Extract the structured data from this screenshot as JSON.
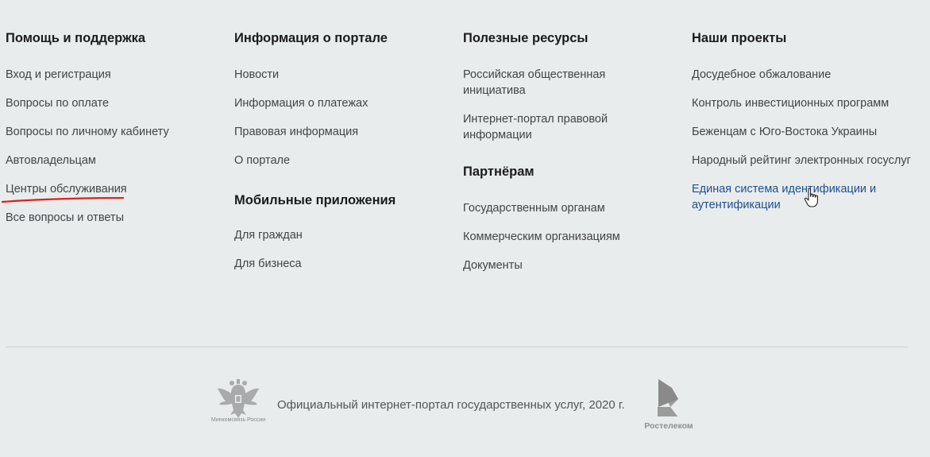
{
  "columns": [
    {
      "title": "Помощь и поддержка",
      "links": [
        "Вход и регистрация",
        "Вопросы по оплате",
        "Вопросы по личному кабинету",
        "Автовладельцам",
        "Центры обслуживания",
        "Все вопросы и ответы"
      ]
    },
    {
      "title": "Информация о портале",
      "links": [
        "Новости",
        "Информация о платежах",
        "Правовая информация",
        "О портале"
      ],
      "title2": "Мобильные приложения",
      "links2": [
        "Для граждан",
        "Для бизнеса"
      ]
    },
    {
      "title": "Полезные ресурсы",
      "links": [
        "Российская общественная инициатива",
        "Интернет-портал правовой информации"
      ],
      "title2": "Партнёрам",
      "links2": [
        "Государственным органам",
        "Коммерческим организациям",
        "Документы"
      ]
    },
    {
      "title": "Наши проекты",
      "links": [
        "Досудебное обжалование",
        "Контроль инвестиционных программ",
        "Беженцам с Юго-Востока Украины",
        "Народный рейтинг электронных госуслуг",
        "Единая система идентификации и аутентификации"
      ]
    }
  ],
  "footer": {
    "emblem_caption": "Минкомсвязь России",
    "copyright": "Официальный интернет-портал государственных услуг, 2020 г.",
    "rostelecom": "Ростелеком",
    "icons": [
      "coat-of-arms-icon",
      "rostelecom-logo-icon",
      "hand-cursor-icon"
    ]
  },
  "colors": {
    "background": "#e8ecec",
    "link": "#444444",
    "link_active": "#1f4e8c",
    "annotation_underline": "#e0201b"
  }
}
